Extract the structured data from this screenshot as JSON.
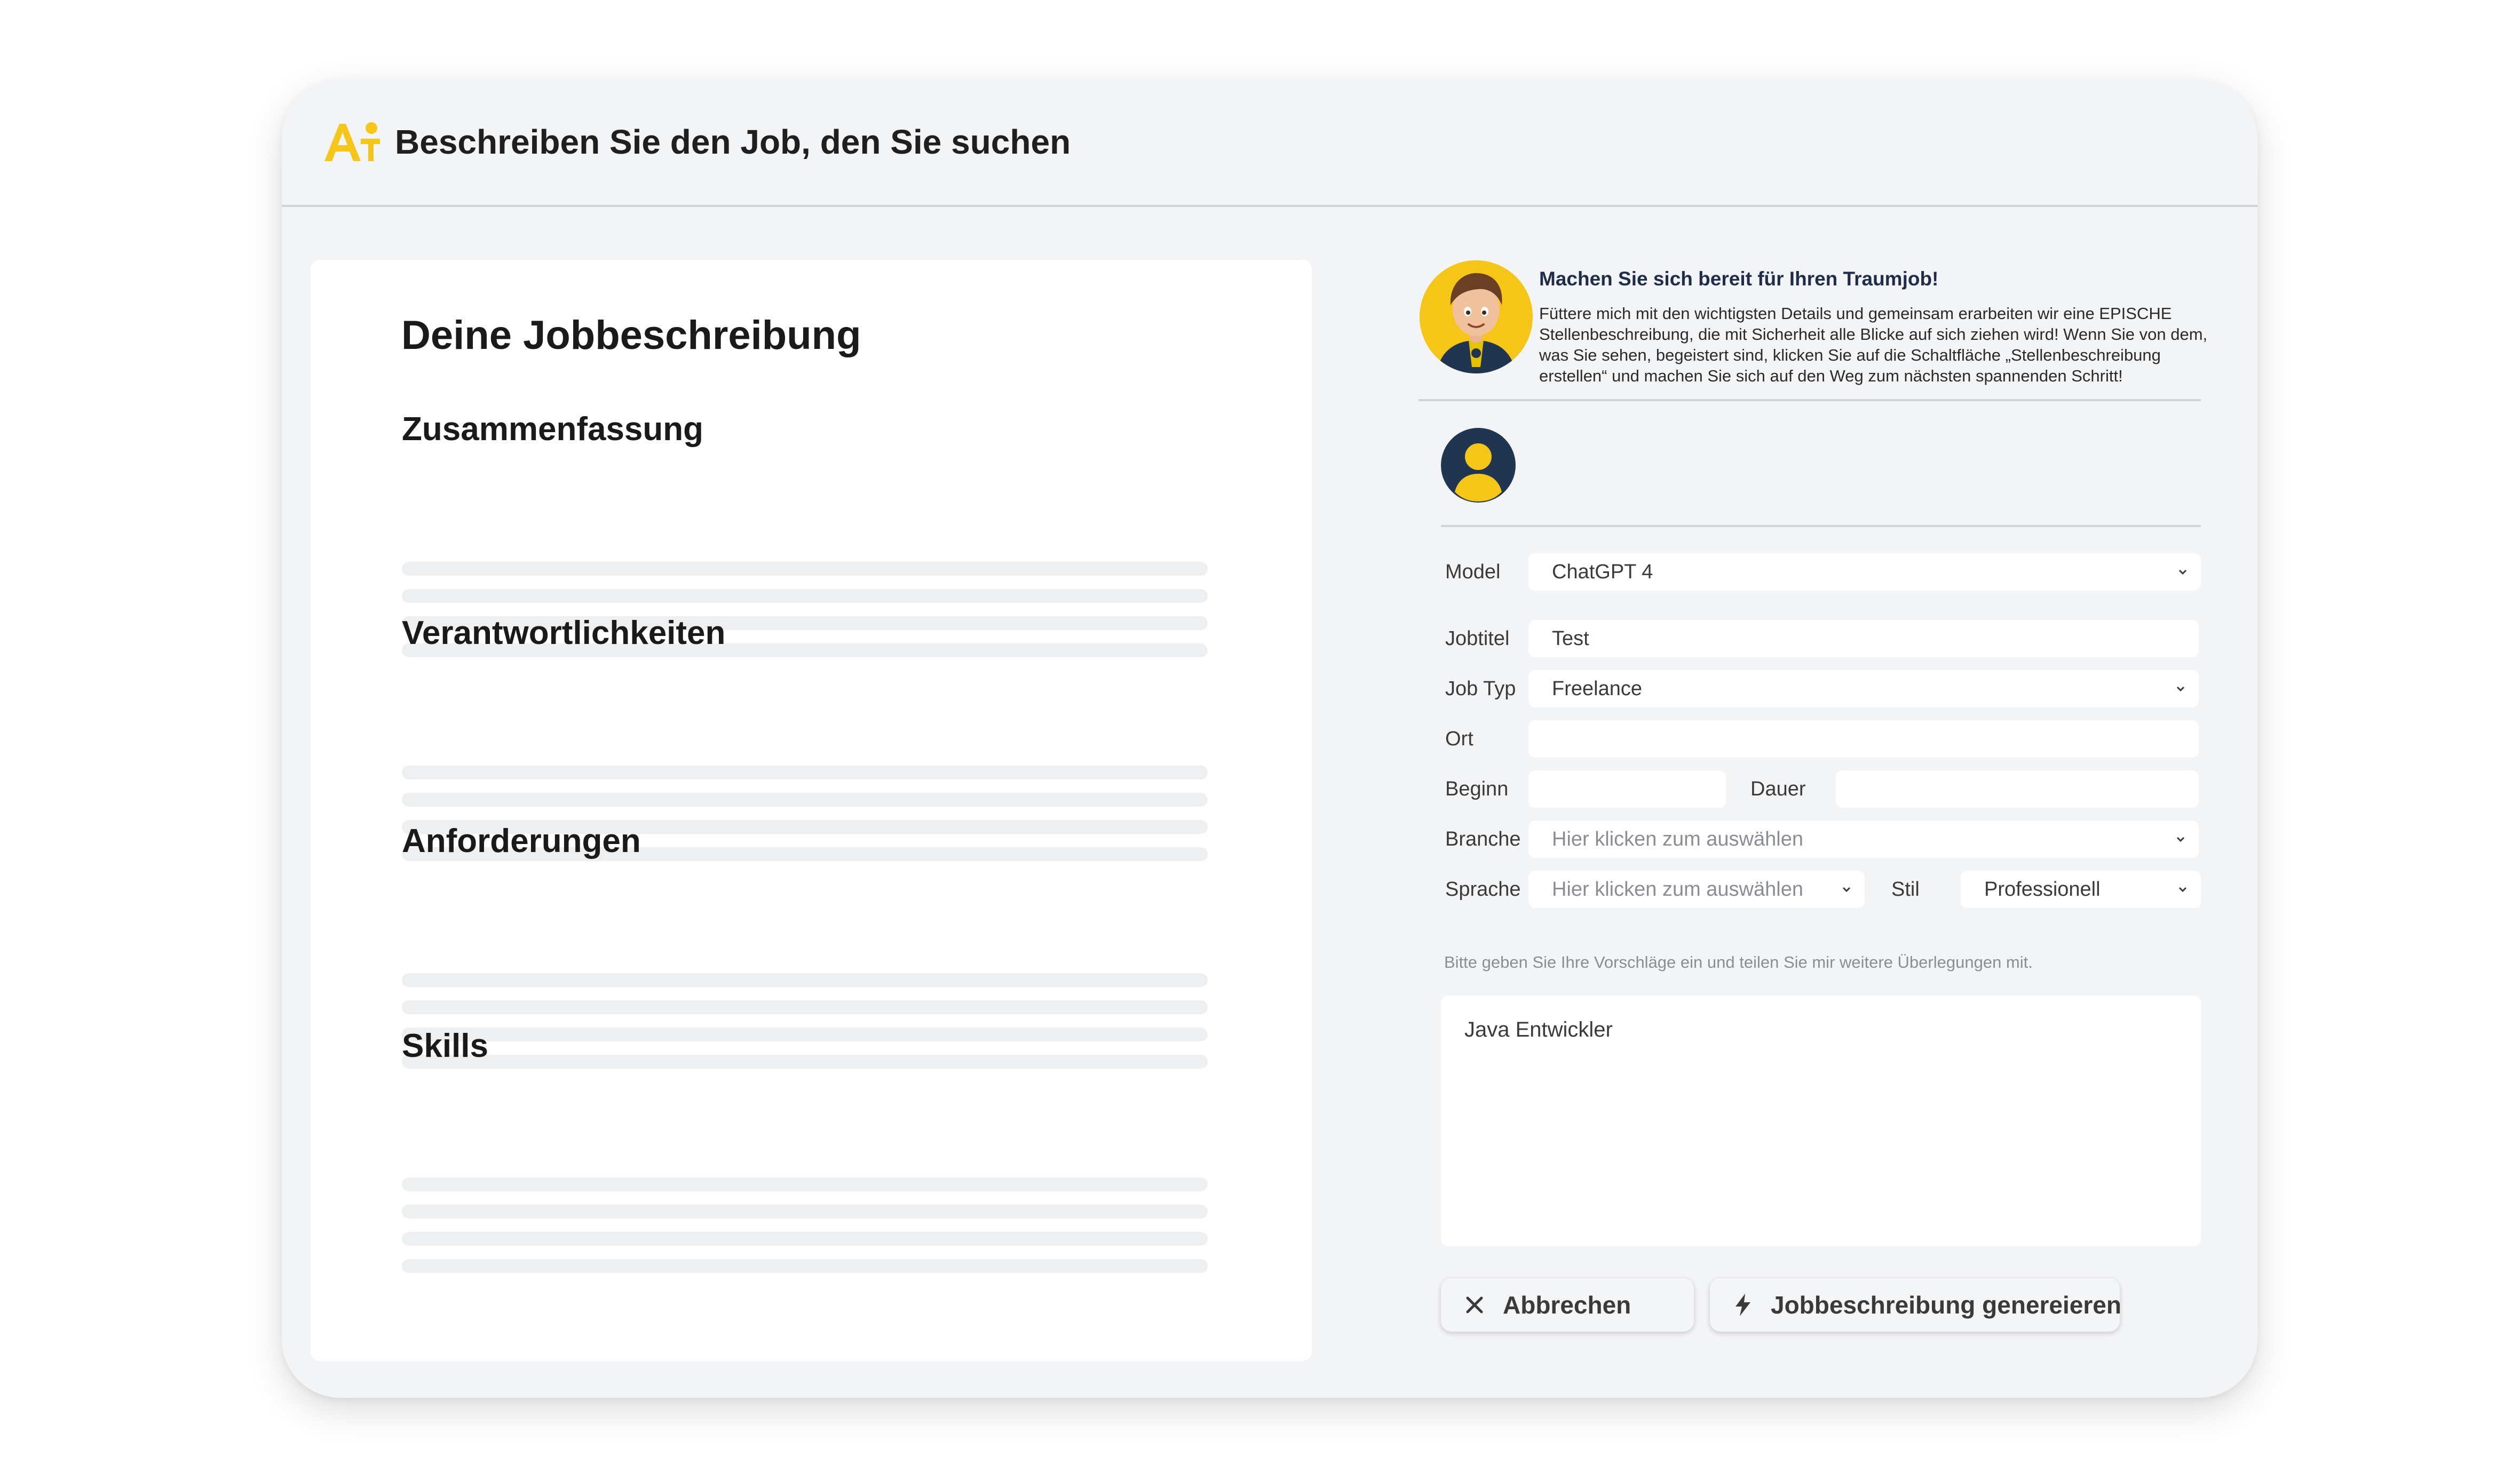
{
  "header": {
    "title": "Beschreiben Sie den Job, den Sie suchen",
    "logo_icon": "ai-person-logo-icon",
    "accent_color": "#f5c518"
  },
  "document": {
    "title": "Deine Jobbeschreibung",
    "sections": [
      {
        "label": "Zusammenfassung"
      },
      {
        "label": "Verantwortlichkeiten"
      },
      {
        "label": "Anforderungen"
      },
      {
        "label": "Skills"
      }
    ]
  },
  "assistant": {
    "avatar_icon": "assistant-avatar-icon",
    "heading": "Machen Sie sich bereit für Ihren Traumjob!",
    "text": "Füttere mich mit den wichtigsten Details und gemeinsam erarbeiten wir eine EPISCHE Stellenbeschreibung, die mit Sicherheit alle Blicke auf sich ziehen wird! Wenn Sie von dem, was Sie sehen, begeistert sind, klicken Sie auf die Schaltfläche „Stellenbeschreibung erstellen“ und machen Sie sich auf den Weg zum nächsten spannenden Schritt!"
  },
  "user": {
    "avatar_icon": "user-avatar-icon"
  },
  "form": {
    "model": {
      "label": "Model",
      "value": "ChatGPT 4"
    },
    "jobtitel": {
      "label": "Jobtitel",
      "value": "Test"
    },
    "job_typ": {
      "label": "Job Typ",
      "value": "Freelance"
    },
    "ort": {
      "label": "Ort",
      "value": ""
    },
    "beginn": {
      "label": "Beginn",
      "value": ""
    },
    "dauer": {
      "label": "Dauer",
      "value": ""
    },
    "branche": {
      "label": "Branche",
      "placeholder": "Hier klicken zum auswählen"
    },
    "sprache": {
      "label": "Sprache",
      "placeholder": "Hier klicken zum auswählen"
    },
    "stil": {
      "label": "Stil",
      "value": "Professionell"
    },
    "hint": "Bitte geben Sie Ihre Vorschläge ein und teilen Sie mir weitere Überlegungen mit.",
    "suggestions": "Java Entwickler"
  },
  "actions": {
    "cancel_label": "Abbrechen",
    "cancel_icon": "close-icon",
    "generate_label": "Jobbeschreibung genereieren",
    "generate_icon": "lightning-icon"
  }
}
